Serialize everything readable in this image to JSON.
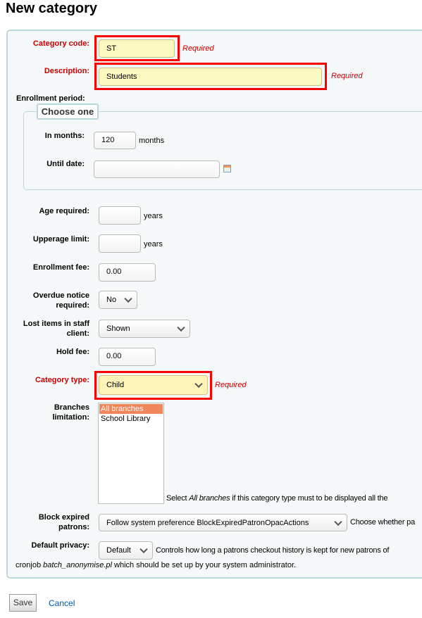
{
  "title": "New category",
  "required_label": "Required",
  "category_code": {
    "label": "Category code:",
    "value": "ST"
  },
  "description": {
    "label": "Description:",
    "value": "Students"
  },
  "enrollment_period": {
    "label": "Enrollment period:",
    "legend": "Choose one",
    "in_months_label": "In months:",
    "in_months_value": "120",
    "months_unit": "months",
    "until_date_label": "Until date:",
    "until_date_value": ""
  },
  "age_required": {
    "label": "Age required:",
    "value": "",
    "unit": "years"
  },
  "upperage_limit": {
    "label": "Upperage limit:",
    "value": "",
    "unit": "years"
  },
  "enrollment_fee": {
    "label": "Enrollment fee:",
    "value": "0.00"
  },
  "overdue_notice": {
    "label_1": "Overdue notice",
    "label_2": "required:",
    "value": "No"
  },
  "lost_items": {
    "label_1": "Lost items in staff",
    "label_2": "client:",
    "value": "Shown"
  },
  "hold_fee": {
    "label": "Hold fee:",
    "value": "0.00"
  },
  "category_type": {
    "label": "Category type:",
    "value": "Child"
  },
  "branches": {
    "label_1": "Branches",
    "label_2": "limitation:",
    "options": [
      "All branches",
      "School Library"
    ],
    "selected": "All branches",
    "help_pre": "Select ",
    "help_em": "All branches",
    "help_post": " if this category type must to be displayed all the"
  },
  "block_expired": {
    "label_1": "Block expired",
    "label_2": "patrons:",
    "value": "Follow system preference BlockExpiredPatronOpacActions",
    "help": "Choose whether pa"
  },
  "default_privacy": {
    "label": "Default privacy:",
    "value": "Default",
    "help": "Controls how long a patrons checkout history is kept for new patrons of",
    "help2_pre": "cronjob ",
    "help2_em": "batch_anonymise.pl",
    "help2_post": " which should be set up by your system administrator."
  },
  "actions": {
    "save": "Save",
    "cancel": "Cancel"
  },
  "colors": {
    "required": "#cc0000",
    "highlight": "#ff0000",
    "fieldset_bg": "#f4f8f9",
    "fieldset_border": "#b9d8d9",
    "link": "#0055aa",
    "selected_option": "#f0875a"
  }
}
